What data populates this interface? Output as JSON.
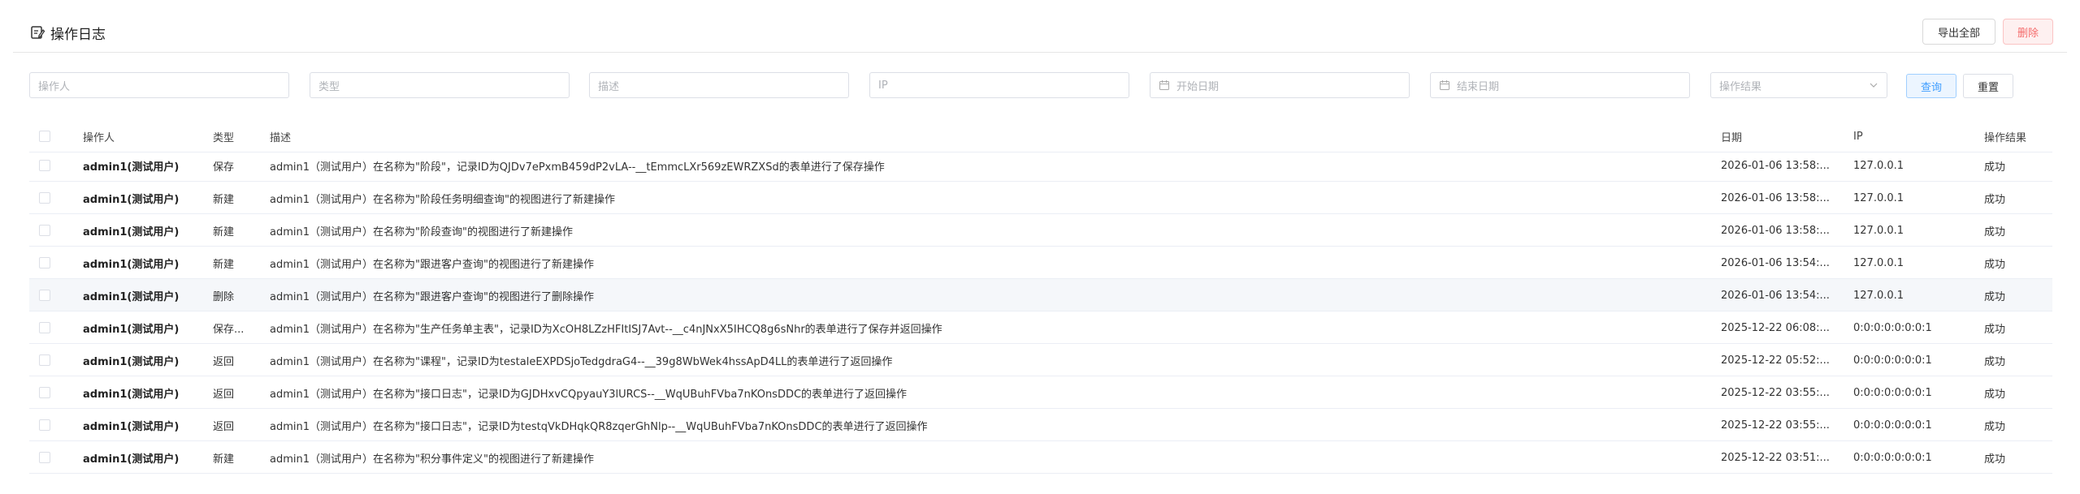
{
  "header": {
    "title": "操作日志",
    "export_label": "导出全部",
    "delete_label": "删除"
  },
  "filters": {
    "operator_placeholder": "操作人",
    "type_placeholder": "类型",
    "desc_placeholder": "描述",
    "ip_placeholder": "IP",
    "start_date_placeholder": "开始日期",
    "end_date_placeholder": "结束日期",
    "result_placeholder": "操作结果",
    "query_label": "查询",
    "reset_label": "重置"
  },
  "table": {
    "columns": {
      "operator": "操作人",
      "type": "类型",
      "desc": "描述",
      "date": "日期",
      "ip": "IP",
      "result": "操作结果"
    },
    "rows": [
      {
        "operator": "admin1(测试用户)",
        "type": "保存",
        "desc": "admin1（测试用户）在名称为\"阶段\"，记录ID为QJDv7ePxmB459dP2vLA--__tEmmcLXr569zEWRZXSd的表单进行了保存操作",
        "date": "2026-01-06 13:58:...",
        "ip": "127.0.0.1",
        "result": "成功"
      },
      {
        "operator": "admin1(测试用户)",
        "type": "新建",
        "desc": "admin1（测试用户）在名称为\"阶段任务明细查询\"的视图进行了新建操作",
        "date": "2026-01-06 13:58:...",
        "ip": "127.0.0.1",
        "result": "成功"
      },
      {
        "operator": "admin1(测试用户)",
        "type": "新建",
        "desc": "admin1（测试用户）在名称为\"阶段查询\"的视图进行了新建操作",
        "date": "2026-01-06 13:58:...",
        "ip": "127.0.0.1",
        "result": "成功"
      },
      {
        "operator": "admin1(测试用户)",
        "type": "新建",
        "desc": "admin1（测试用户）在名称为\"跟进客户查询\"的视图进行了新建操作",
        "date": "2026-01-06 13:54:...",
        "ip": "127.0.0.1",
        "result": "成功"
      },
      {
        "operator": "admin1(测试用户)",
        "type": "删除",
        "desc": "admin1（测试用户）在名称为\"跟进客户查询\"的视图进行了删除操作",
        "date": "2026-01-06 13:54:...",
        "ip": "127.0.0.1",
        "result": "成功"
      },
      {
        "operator": "admin1(测试用户)",
        "type": "保存...",
        "desc": "admin1（测试用户）在名称为\"生产任务单主表\"，记录ID为XcOH8LZzHFItISJ7Avt--__c4nJNxX5IHCQ8g6sNhr的表单进行了保存并返回操作",
        "date": "2025-12-22 06:08:...",
        "ip": "0:0:0:0:0:0:0:1",
        "result": "成功"
      },
      {
        "operator": "admin1(测试用户)",
        "type": "返回",
        "desc": "admin1（测试用户）在名称为\"课程\"，记录ID为testaleEXPDSjoTedgdraG4--__39g8WbWek4hssApD4LL的表单进行了返回操作",
        "date": "2025-12-22 05:52:...",
        "ip": "0:0:0:0:0:0:0:1",
        "result": "成功"
      },
      {
        "operator": "admin1(测试用户)",
        "type": "返回",
        "desc": "admin1（测试用户）在名称为\"接口日志\"，记录ID为GJDHxvCQpyauY3lURCS--__WqUBuhFVba7nKOnsDDC的表单进行了返回操作",
        "date": "2025-12-22 03:55:...",
        "ip": "0:0:0:0:0:0:0:1",
        "result": "成功"
      },
      {
        "operator": "admin1(测试用户)",
        "type": "返回",
        "desc": "admin1（测试用户）在名称为\"接口日志\"，记录ID为testqVkDHqkQR8zqerGhNlp--__WqUBuhFVba7nKOnsDDC的表单进行了返回操作",
        "date": "2025-12-22 03:55:...",
        "ip": "0:0:0:0:0:0:0:1",
        "result": "成功"
      },
      {
        "operator": "admin1(测试用户)",
        "type": "新建",
        "desc": "admin1（测试用户）在名称为\"积分事件定义\"的视图进行了新建操作",
        "date": "2025-12-22 03:51:...",
        "ip": "0:0:0:0:0:0:0:1",
        "result": "成功"
      }
    ]
  }
}
